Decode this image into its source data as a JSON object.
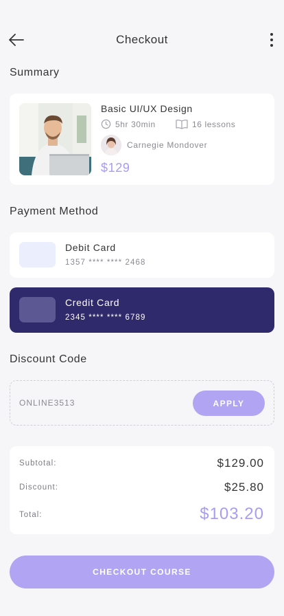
{
  "header": {
    "title": "Checkout"
  },
  "summary": {
    "title": "Summary",
    "course": {
      "name": "Basic UI/UX Design",
      "duration": "5hr 30min",
      "lessons": "16 lessons",
      "instructor": "Carnegie Mondover",
      "price": "$129"
    }
  },
  "payment": {
    "title": "Payment Method",
    "methods": [
      {
        "name": "Debit Card",
        "number": "1357 **** **** 2468",
        "selected": false
      },
      {
        "name": "Credit Card",
        "number": "2345 **** **** 6789",
        "selected": true
      }
    ]
  },
  "discount": {
    "title": "Discount Code",
    "code": "ONLINE3513",
    "apply_label": "APPLY"
  },
  "totals": {
    "subtotal_label": "Subtotal:",
    "subtotal_value": "$129.00",
    "discount_label": "Discount:",
    "discount_value": "$25.80",
    "total_label": "Total:",
    "total_value": "$103.20"
  },
  "checkout_label": "CHECKOUT COURSE",
  "colors": {
    "accent": "#b0a4f3",
    "price": "#a99cf2",
    "selected_card": "#2f2a6b"
  },
  "icons": {
    "back": "arrow-left-icon",
    "more": "more-vertical-icon",
    "duration": "clock-icon",
    "lessons": "book-icon"
  }
}
